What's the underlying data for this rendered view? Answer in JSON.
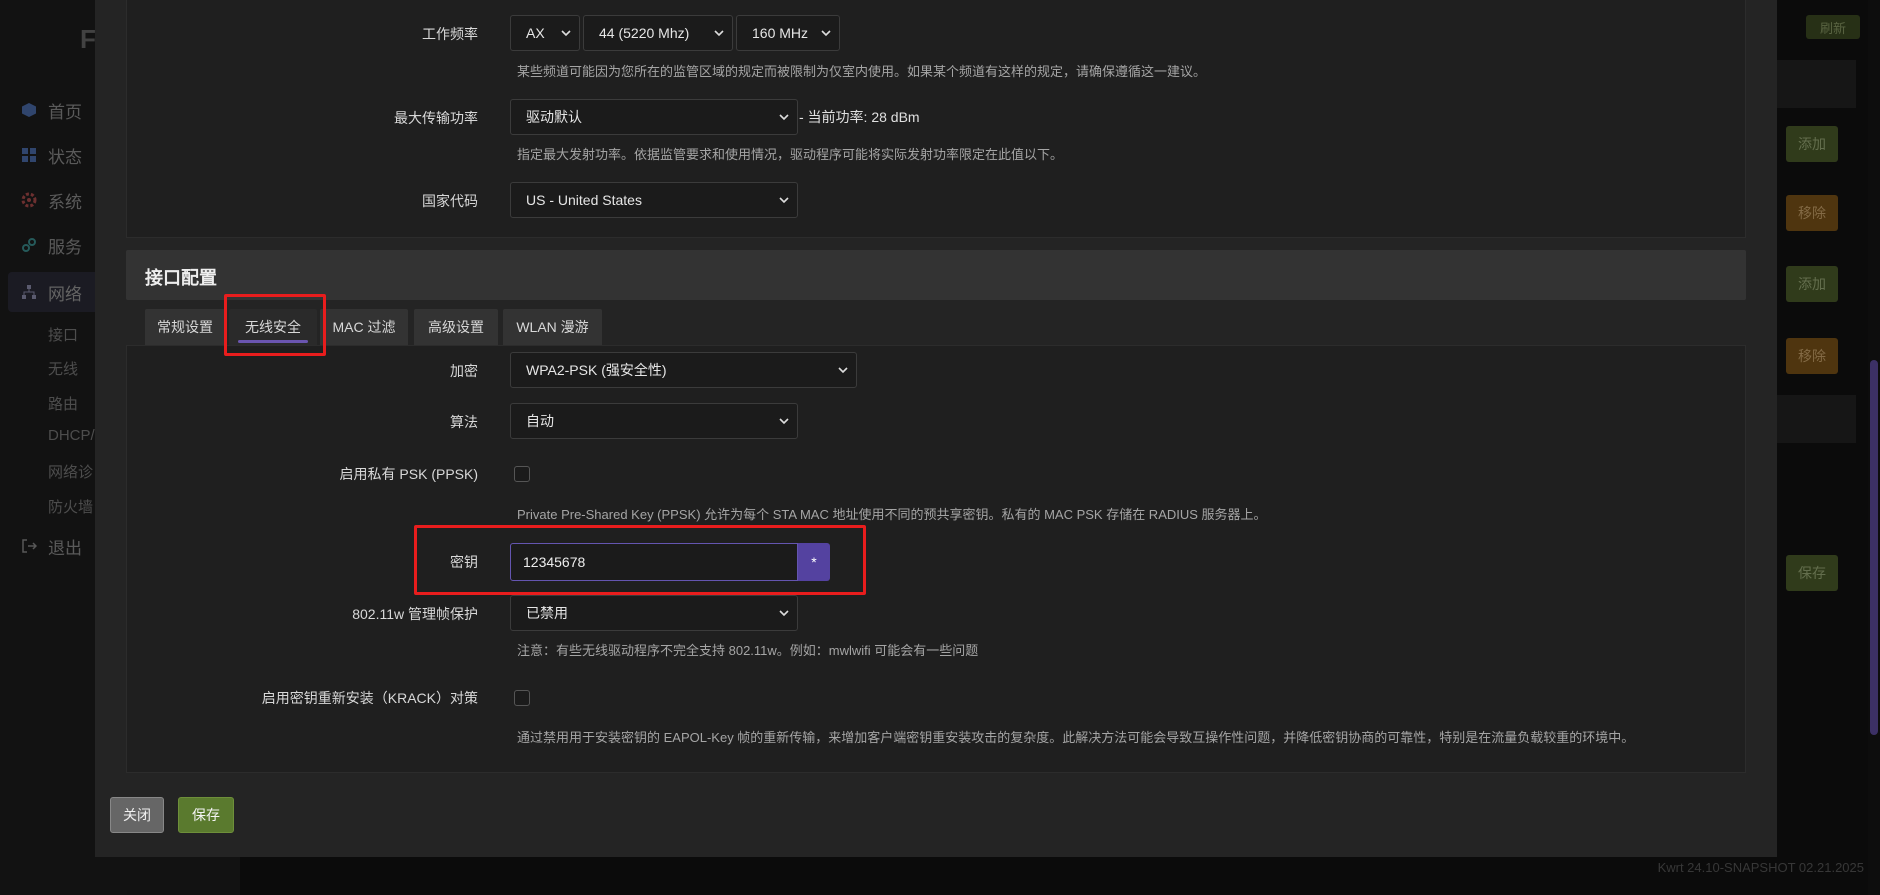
{
  "background": {
    "brand": "F",
    "nav": [
      {
        "label": "首页",
        "icon": "cube-icon"
      },
      {
        "label": "状态",
        "icon": "dashboard-icon"
      },
      {
        "label": "系统",
        "icon": "gear-icon"
      },
      {
        "label": "服务",
        "icon": "link-icon"
      },
      {
        "label": "网络",
        "icon": "network-icon"
      }
    ],
    "subnav": [
      "接口",
      "无线",
      "路由",
      "DHCP/D",
      "网络诊",
      "防火墙"
    ],
    "logout": "退出",
    "refresh_label": "刷新",
    "side_buttons": [
      "添加",
      "移除",
      "添加",
      "移除",
      "保存"
    ],
    "version": "Kwrt 24.10-SNAPSHOT 02.21.2025"
  },
  "device_config": {
    "frequency": {
      "label": "工作频率",
      "mode": "AX",
      "channel": "44 (5220 Mhz)",
      "width": "160 MHz",
      "hint": "某些频道可能因为您所在的监管区域的规定而被限制为仅室内使用。如果某个频道有这样的规定，请确保遵循这一建议。"
    },
    "txpower": {
      "label": "最大传输功率",
      "value": "驱动默认",
      "current": "- 当前功率: 28 dBm",
      "hint": "指定最大发射功率。依据监管要求和使用情况，驱动程序可能将实际发射功率限定在此值以下。"
    },
    "country": {
      "label": "国家代码",
      "value": "US - United States"
    }
  },
  "interface_config": {
    "title": "接口配置",
    "tabs": [
      "常规设置",
      "无线安全",
      "MAC 过滤",
      "高级设置",
      "WLAN 漫游"
    ],
    "active_tab": "无线安全",
    "encryption": {
      "label": "加密",
      "value": "WPA2-PSK (强安全性)"
    },
    "cipher": {
      "label": "算法",
      "value": "自动"
    },
    "ppsk": {
      "label": "启用私有 PSK (PPSK)",
      "checked": false,
      "hint": "Private Pre-Shared Key (PPSK) 允许为每个 STA MAC 地址使用不同的预共享密钥。私有的 MAC PSK 存储在 RADIUS 服务器上。"
    },
    "key": {
      "label": "密钥",
      "value": "12345678",
      "reveal_symbol": "*"
    },
    "ieee80211w": {
      "label": "802.11w 管理帧保护",
      "value": "已禁用",
      "hint": "注意：有些无线驱动程序不完全支持 802.11w。例如：mwlwifi 可能会有一些问题"
    },
    "krack": {
      "label": "启用密钥重新安装（KRACK）对策",
      "checked": false,
      "hint": "通过禁用用于安装密钥的 EAPOL-Key 帧的重新传输，来增加客户端密钥重安装攻击的复杂度。此解决方法可能会导致互操作性问题，并降低密钥协商的可靠性，特别是在流量负载较重的环境中。"
    }
  },
  "footer": {
    "close_label": "关闭",
    "save_label": "保存"
  },
  "colors": {
    "accent": "#5442a0",
    "highlight": "#e81d1d",
    "save": "#5a7a2e"
  }
}
